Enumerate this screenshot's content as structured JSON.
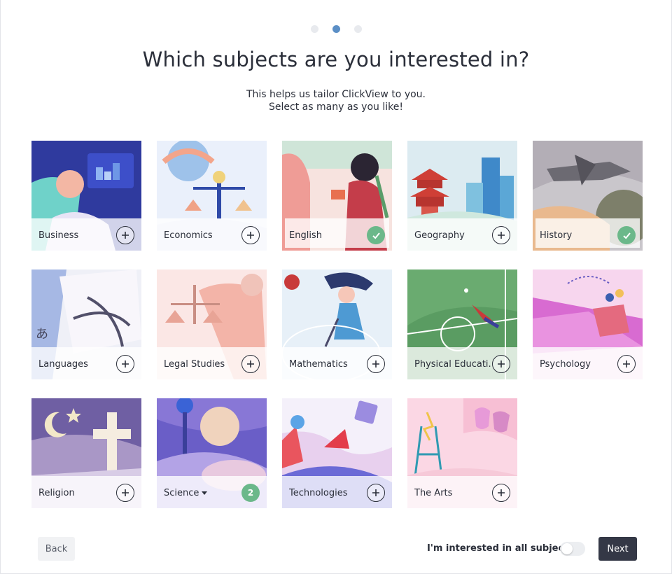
{
  "pagination": {
    "total": 3,
    "current": 2
  },
  "header": {
    "title": "Which subjects are you interested in?",
    "subtitle_line1": "This helps us tailor ClickView to you.",
    "subtitle_line2": "Select as many as you like!"
  },
  "subjects": [
    {
      "label": "Business",
      "state": "add"
    },
    {
      "label": "Economics",
      "state": "add"
    },
    {
      "label": "English",
      "state": "selected"
    },
    {
      "label": "Geography",
      "state": "add"
    },
    {
      "label": "History",
      "state": "selected"
    },
    {
      "label": "Languages",
      "state": "add"
    },
    {
      "label": "Legal Studies",
      "state": "add"
    },
    {
      "label": "Mathematics",
      "state": "add"
    },
    {
      "label": "Physical Educati...",
      "state": "add"
    },
    {
      "label": "Psychology",
      "state": "add"
    },
    {
      "label": "Religion",
      "state": "add"
    },
    {
      "label": "Science",
      "state": "count",
      "count": "2",
      "has_dropdown": true
    },
    {
      "label": "Technologies",
      "state": "add"
    },
    {
      "label": "The Arts",
      "state": "add"
    }
  ],
  "footer": {
    "back_label": "Back",
    "all_subjects_label": "I'm interested in all subjects",
    "all_subjects_on": false,
    "next_label": "Next"
  },
  "colors": {
    "selected_accent": "#6bb88a",
    "active_dot": "#5b8fc6",
    "primary_button": "#343846"
  },
  "icons": {
    "add": "plus-circle-icon",
    "selected": "check-circle-icon",
    "dropdown": "caret-down-icon"
  }
}
